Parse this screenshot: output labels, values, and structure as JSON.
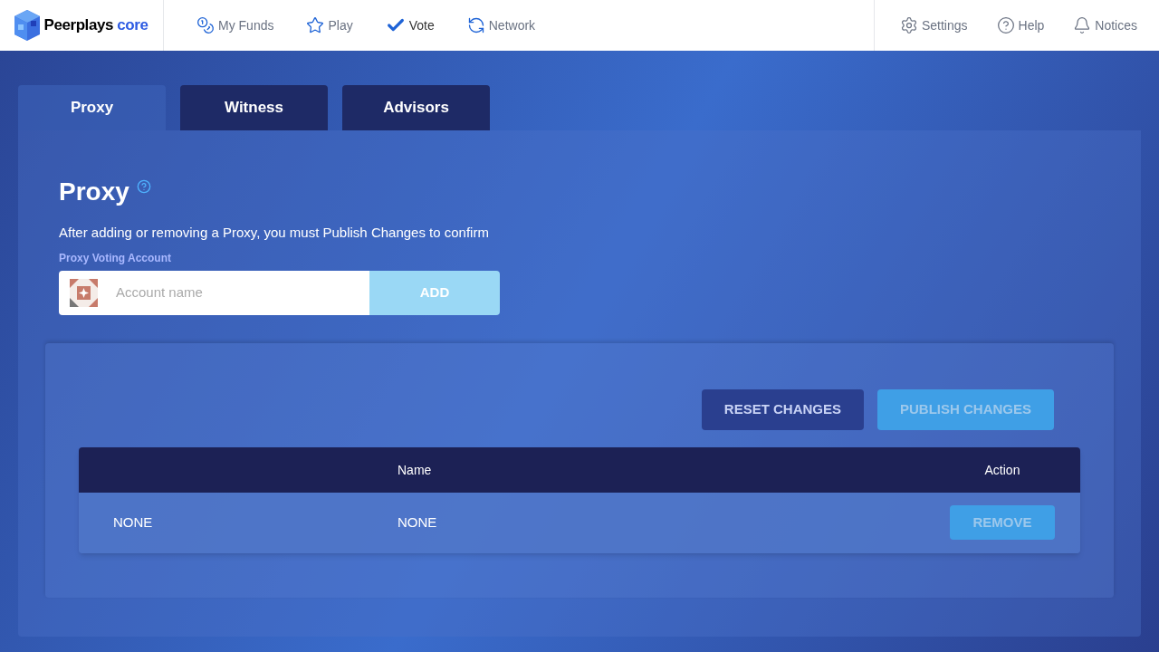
{
  "logo": {
    "name": "Peerplays",
    "suffix": "core"
  },
  "nav": [
    {
      "label": "My Funds",
      "selected": false
    },
    {
      "label": "Play",
      "selected": false
    },
    {
      "label": "Vote",
      "selected": true
    },
    {
      "label": "Network",
      "selected": false
    }
  ],
  "nav_right": [
    {
      "label": "Settings"
    },
    {
      "label": "Help"
    },
    {
      "label": "Notices"
    }
  ],
  "tabs": [
    {
      "label": "Proxy",
      "selected": true
    },
    {
      "label": "Witness",
      "selected": false
    },
    {
      "label": "Advisors",
      "selected": false
    }
  ],
  "title": "Proxy",
  "info": "After adding or removing a Proxy, you must Publish Changes to confirm",
  "field": {
    "label": "Proxy Voting Account",
    "placeholder": "Account name",
    "button": {
      "label": "ADD",
      "disabled": true
    }
  },
  "actions": [
    {
      "label": "RESET CHANGES",
      "disabled": false
    },
    {
      "label": "PUBLISH CHANGES",
      "disabled": true
    }
  ],
  "table": {
    "columns": [
      "Name",
      "Action"
    ],
    "rows": [
      {
        "column_1": "NONE",
        "name": "NONE",
        "action": {
          "label": "REMOVE",
          "disabled": true
        }
      }
    ]
  }
}
